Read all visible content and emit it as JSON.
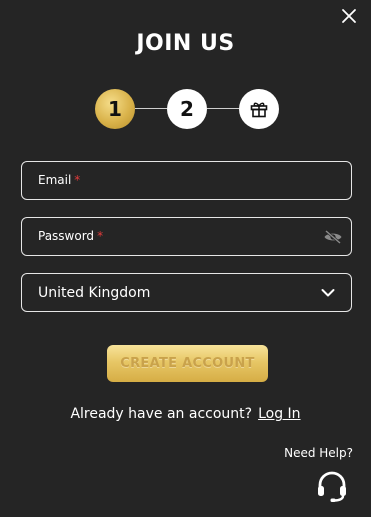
{
  "modal": {
    "title": "JOIN US",
    "close_icon": "close-icon"
  },
  "stepper": {
    "steps": [
      {
        "label": "1",
        "state": "active",
        "color": "#d9b24a"
      },
      {
        "label": "2",
        "state": "inactive"
      },
      {
        "label": "",
        "icon": "gift-icon",
        "state": "inactive"
      }
    ]
  },
  "form": {
    "email": {
      "label": "Email",
      "required_mark": "*",
      "value": ""
    },
    "password": {
      "label": "Password",
      "required_mark": "*",
      "value": "",
      "toggle_icon": "eye-off-icon"
    },
    "country": {
      "selected": "United Kingdom",
      "icon": "chevron-down-icon"
    },
    "submit_label": "CREATE ACCOUNT"
  },
  "login": {
    "prompt": "Already have an account?",
    "link_label": "Log In"
  },
  "help": {
    "label": "Need Help?",
    "icon": "headset-icon"
  },
  "colors": {
    "background": "#252525",
    "accent_gold": "#d9b24a",
    "required": "#e23b3b"
  }
}
